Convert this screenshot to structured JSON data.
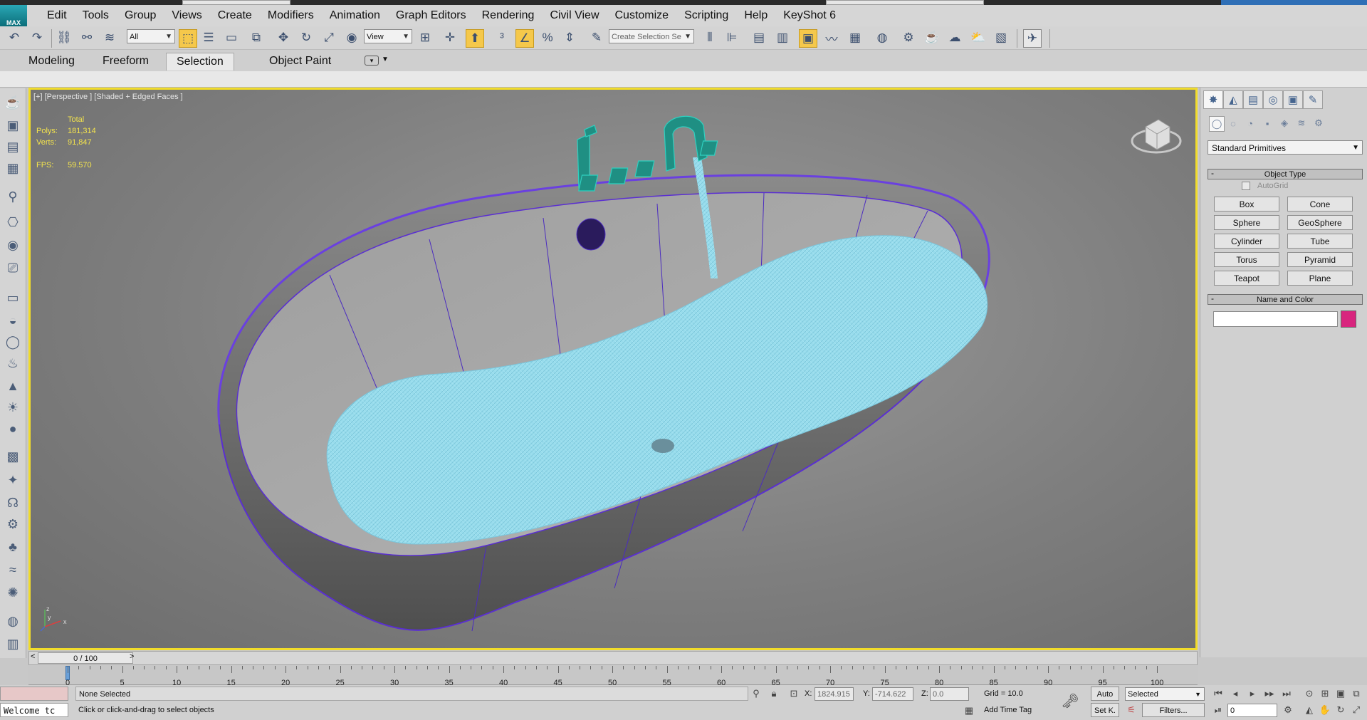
{
  "menu": {
    "logo": "MAX",
    "items": [
      "Edit",
      "Tools",
      "Group",
      "Views",
      "Create",
      "Modifiers",
      "Animation",
      "Graph Editors",
      "Rendering",
      "Civil View",
      "Customize",
      "Scripting",
      "Help",
      "KeyShot 6"
    ]
  },
  "toolbar": {
    "selection_filter": "All",
    "reference_coord": "View",
    "named_selection_placeholder": "Create Selection Se",
    "icons": [
      "undo-icon",
      "redo-icon",
      "link-icon",
      "unlink-icon",
      "bind-spacewarp-icon",
      "select-object-icon",
      "select-by-name-icon",
      "rect-selection-icon",
      "window-crossing-icon",
      "move-icon",
      "rotate-icon",
      "scale-icon",
      "placement-icon",
      "pivot-icon",
      "manipulate-icon",
      "keyboard-shortcut-icon",
      "snap-3d-icon",
      "angle-snap-icon",
      "percent-snap-icon",
      "spinner-snap-icon",
      "edit-named-selection-icon",
      "mirror-icon",
      "align-icon",
      "layer-explorer-icon",
      "scene-explorer-icon",
      "ribbon-toggle-icon",
      "curve-editor-icon",
      "schematic-view-icon",
      "material-editor-icon",
      "render-setup-icon",
      "rendered-frame-icon",
      "render-icon",
      "render-iterative-icon",
      "activeshade-icon",
      "keyshot-icon"
    ]
  },
  "ribbon": {
    "tabs": [
      "Modeling",
      "Freeform",
      "Selection",
      "Object Paint"
    ],
    "selected_tab": "Selection"
  },
  "viewport": {
    "label": "[+] [Perspective ] [Shaded + Edged Faces ]",
    "stats": {
      "total_label": "Total",
      "polys_label": "Polys:",
      "polys_value": "181,314",
      "verts_label": "Verts:",
      "verts_value": "91,847",
      "fps_label": "FPS:",
      "fps_value": "59.570"
    },
    "axis": {
      "z": "z",
      "y": "y",
      "x": "x"
    }
  },
  "command_panel": {
    "dropdown": "Standard Primitives",
    "object_type_title": "Object Type",
    "autogrid_label": "AutoGrid",
    "primitives": [
      "Box",
      "Cone",
      "Sphere",
      "GeoSphere",
      "Cylinder",
      "Tube",
      "Torus",
      "Pyramid",
      "Teapot",
      "Plane"
    ],
    "name_color_title": "Name and Color",
    "object_color": "#d8257e"
  },
  "timeline": {
    "slider_value": "0 / 100",
    "ticks": [
      "0",
      "5",
      "10",
      "15",
      "20",
      "25",
      "30",
      "35",
      "40",
      "45",
      "50",
      "55",
      "60",
      "65",
      "70",
      "75",
      "80",
      "85",
      "90",
      "95",
      "100"
    ]
  },
  "status": {
    "script_listener": "Welcome tc",
    "selection_status": "None Selected",
    "prompt": "Click or click-and-drag to select objects",
    "x_label": "X:",
    "x_value": "1824.915",
    "y_label": "Y:",
    "y_value": "-714.622",
    "z_label": "Z:",
    "z_value": "0.0",
    "grid": "Grid = 10.0",
    "add_time_tag": "Add Time Tag",
    "auto_key": "Auto",
    "set_key": "Set K.",
    "key_mode": "Selected",
    "filters": "Filters...",
    "current_frame": "0"
  },
  "colors": {
    "viewport_border": "#f1dc2a",
    "stats_text": "#f3e34d",
    "water": "#8fd3e6",
    "edges": "#5a2fd1",
    "faucet": "#2fd0c0",
    "active_button": "#f5c84b"
  }
}
